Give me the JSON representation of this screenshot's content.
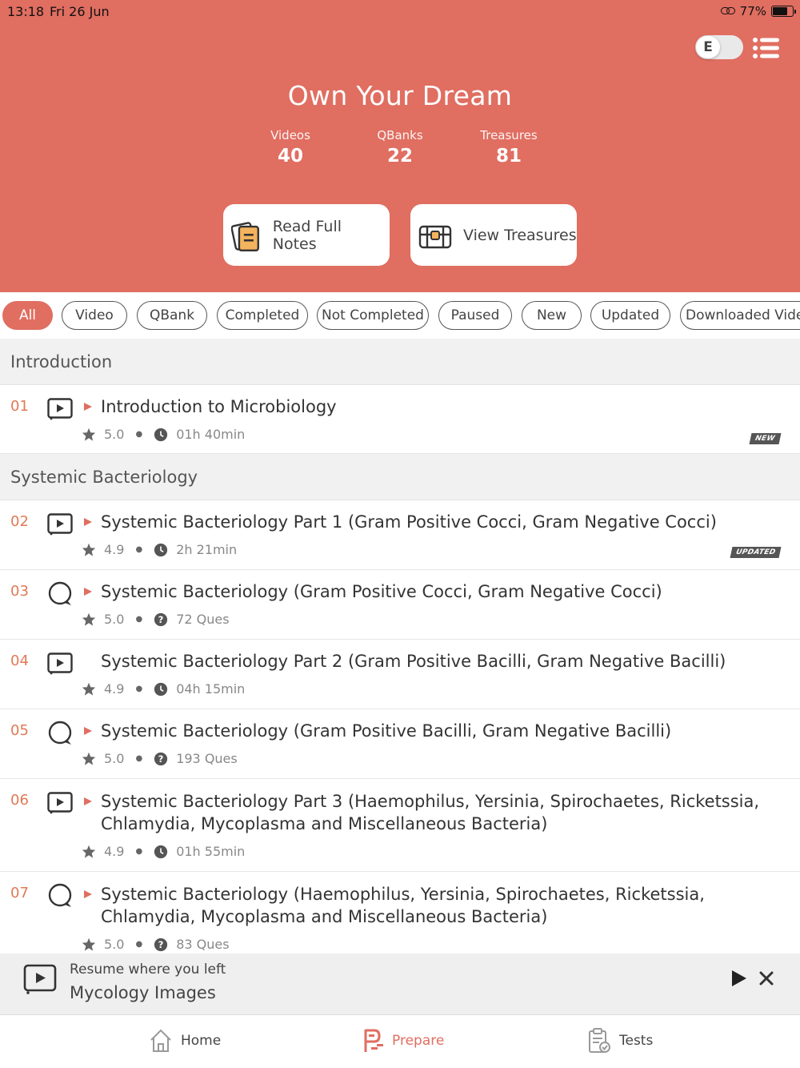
{
  "status": {
    "time": "13:18",
    "date": "Fri 26 Jun",
    "battery": "77%"
  },
  "header": {
    "toggle_letter": "E",
    "title": "Own Your Dream",
    "stats": [
      {
        "label": "Videos",
        "value": "40"
      },
      {
        "label": "QBanks",
        "value": "22"
      },
      {
        "label": "Treasures",
        "value": "81"
      }
    ],
    "buttons": {
      "notes": "Read Full Notes",
      "treasures": "View Treasures"
    }
  },
  "filters": [
    "All",
    "Video",
    "QBank",
    "Completed",
    "Not Completed",
    "Paused",
    "New",
    "Updated",
    "Downloaded Videos"
  ],
  "sections": [
    {
      "title": "Introduction",
      "items": [
        {
          "num": "01",
          "type": "video",
          "title": "Introduction to Microbiology",
          "rating": "5.0",
          "info": "01h 40min",
          "badge": "NEW",
          "played": true
        }
      ]
    },
    {
      "title": "Systemic Bacteriology",
      "items": [
        {
          "num": "02",
          "type": "video",
          "title": "Systemic Bacteriology Part 1 (Gram Positive Cocci, Gram Negative Cocci)",
          "rating": "4.9",
          "info": "2h 21min",
          "badge": "UPDATED",
          "played": true
        },
        {
          "num": "03",
          "type": "qbank",
          "title": "Systemic Bacteriology (Gram Positive Cocci, Gram Negative Cocci)",
          "rating": "5.0",
          "info": "72 Ques",
          "played": true
        },
        {
          "num": "04",
          "type": "video",
          "title": "Systemic Bacteriology Part 2 (Gram Positive Bacilli, Gram Negative Bacilli)",
          "rating": "4.9",
          "info": "04h 15min",
          "played": false
        },
        {
          "num": "05",
          "type": "qbank",
          "title": "Systemic Bacteriology (Gram Positive Bacilli, Gram Negative Bacilli)",
          "rating": "5.0",
          "info": "193 Ques",
          "played": true
        },
        {
          "num": "06",
          "type": "video",
          "title": "Systemic Bacteriology Part 3 (Haemophilus, Yersinia, Spirochaetes, Ricketssia, Chlamydia, Mycoplasma and Miscellaneous Bacteria)",
          "rating": "4.9",
          "info": "01h 55min",
          "played": true
        },
        {
          "num": "07",
          "type": "qbank",
          "title": "Systemic Bacteriology (Haemophilus, Yersinia, Spirochaetes, Ricketssia, Chlamydia, Mycoplasma and Miscellaneous Bacteria)",
          "rating": "5.0",
          "info": "83 Ques",
          "played": true
        }
      ]
    }
  ],
  "resume": {
    "label": "Resume where you left",
    "title": "Mycology Images"
  },
  "tabs": [
    "Home",
    "Prepare",
    "Tests"
  ],
  "colors": {
    "accent": "#e06e61",
    "number": "#e07a55"
  }
}
